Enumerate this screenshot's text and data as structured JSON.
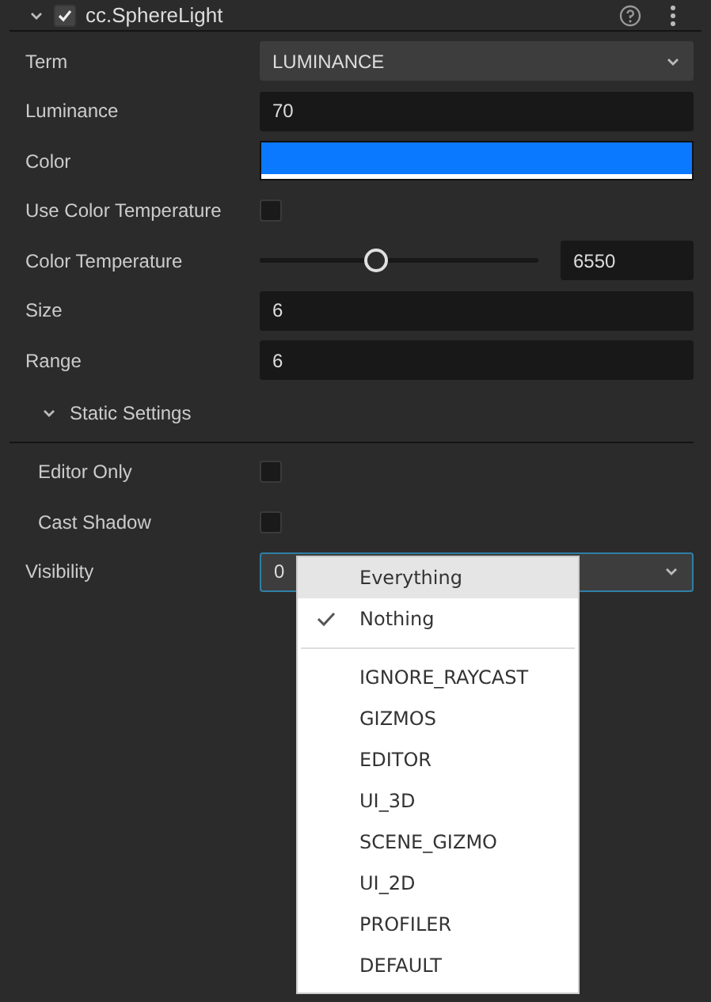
{
  "component": {
    "title": "cc.SphereLight",
    "expanded": true,
    "enabled": true
  },
  "properties": [
    {
      "kind": "select",
      "label": "Term",
      "value": "LUMINANCE"
    },
    {
      "kind": "number",
      "label": "Luminance",
      "value": "70"
    },
    {
      "kind": "color",
      "label": "Color",
      "color": "#0a78ff"
    },
    {
      "kind": "checkbox",
      "label": "Use Color Temperature",
      "checked": false
    },
    {
      "kind": "slider",
      "label": "Color Temperature",
      "level": 0.41,
      "value": "6550"
    },
    {
      "kind": "number",
      "label": "Size",
      "value": "6"
    },
    {
      "kind": "number",
      "label": "Range",
      "value": "6"
    }
  ],
  "static_settings": {
    "label": "Static Settings",
    "expanded": true,
    "children": [
      {
        "kind": "checkbox",
        "label": "Editor Only",
        "checked": false
      },
      {
        "kind": "checkbox",
        "label": "Cast Shadow",
        "checked": false
      }
    ]
  },
  "visibility": {
    "label": "Visibility",
    "value": "0",
    "open": true,
    "menu": [
      {
        "label": "Everything",
        "checked": false,
        "highlighted": true
      },
      {
        "label": "Nothing",
        "checked": true,
        "highlighted": false
      }
    ],
    "layers": [
      {
        "label": "IGNORE_RAYCAST",
        "checked": false,
        "highlighted": false
      },
      {
        "label": "GIZMOS",
        "checked": false,
        "highlighted": false
      },
      {
        "label": "EDITOR",
        "checked": false,
        "highlighted": false
      },
      {
        "label": "UI_3D",
        "checked": false,
        "highlighted": false
      },
      {
        "label": "SCENE_GIZMO",
        "checked": false,
        "highlighted": false
      },
      {
        "label": "UI_2D",
        "checked": false,
        "highlighted": false
      },
      {
        "label": "PROFILER",
        "checked": false,
        "highlighted": false
      },
      {
        "label": "DEFAULT",
        "checked": false,
        "highlighted": false
      }
    ]
  }
}
